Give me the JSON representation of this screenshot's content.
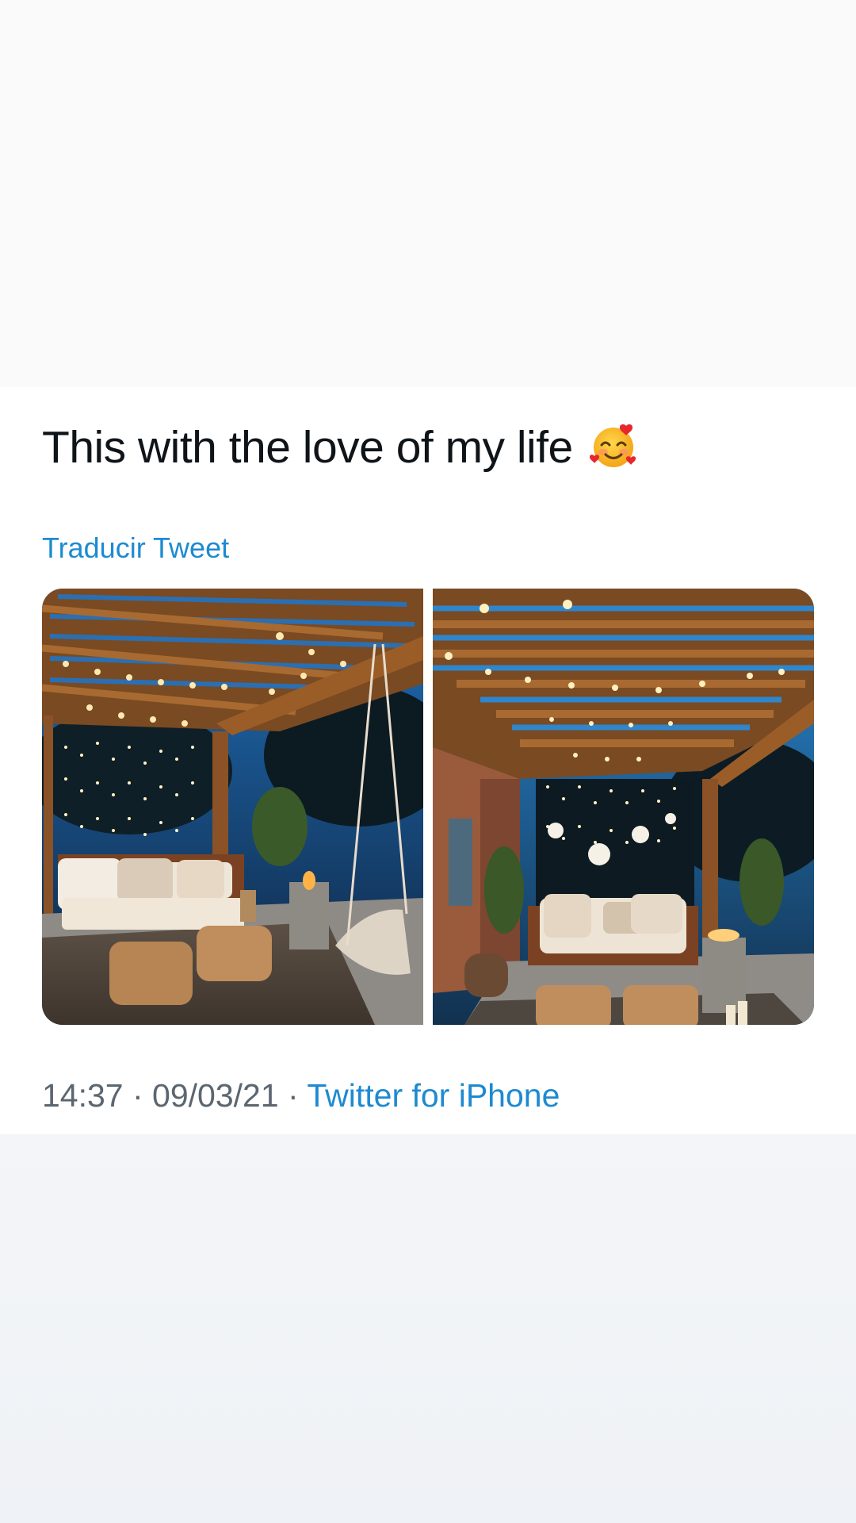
{
  "tweet": {
    "text": "This with the love of my life",
    "emoji_icon": "smiling-face-with-hearts-icon",
    "translate_label": "Traducir Tweet",
    "time": "14:37",
    "separator": " · ",
    "date": "09/03/21",
    "source": "Twitter for iPhone"
  },
  "colors": {
    "link": "#1d8ad0",
    "text": "#0f1419",
    "meta": "#5b6670"
  }
}
